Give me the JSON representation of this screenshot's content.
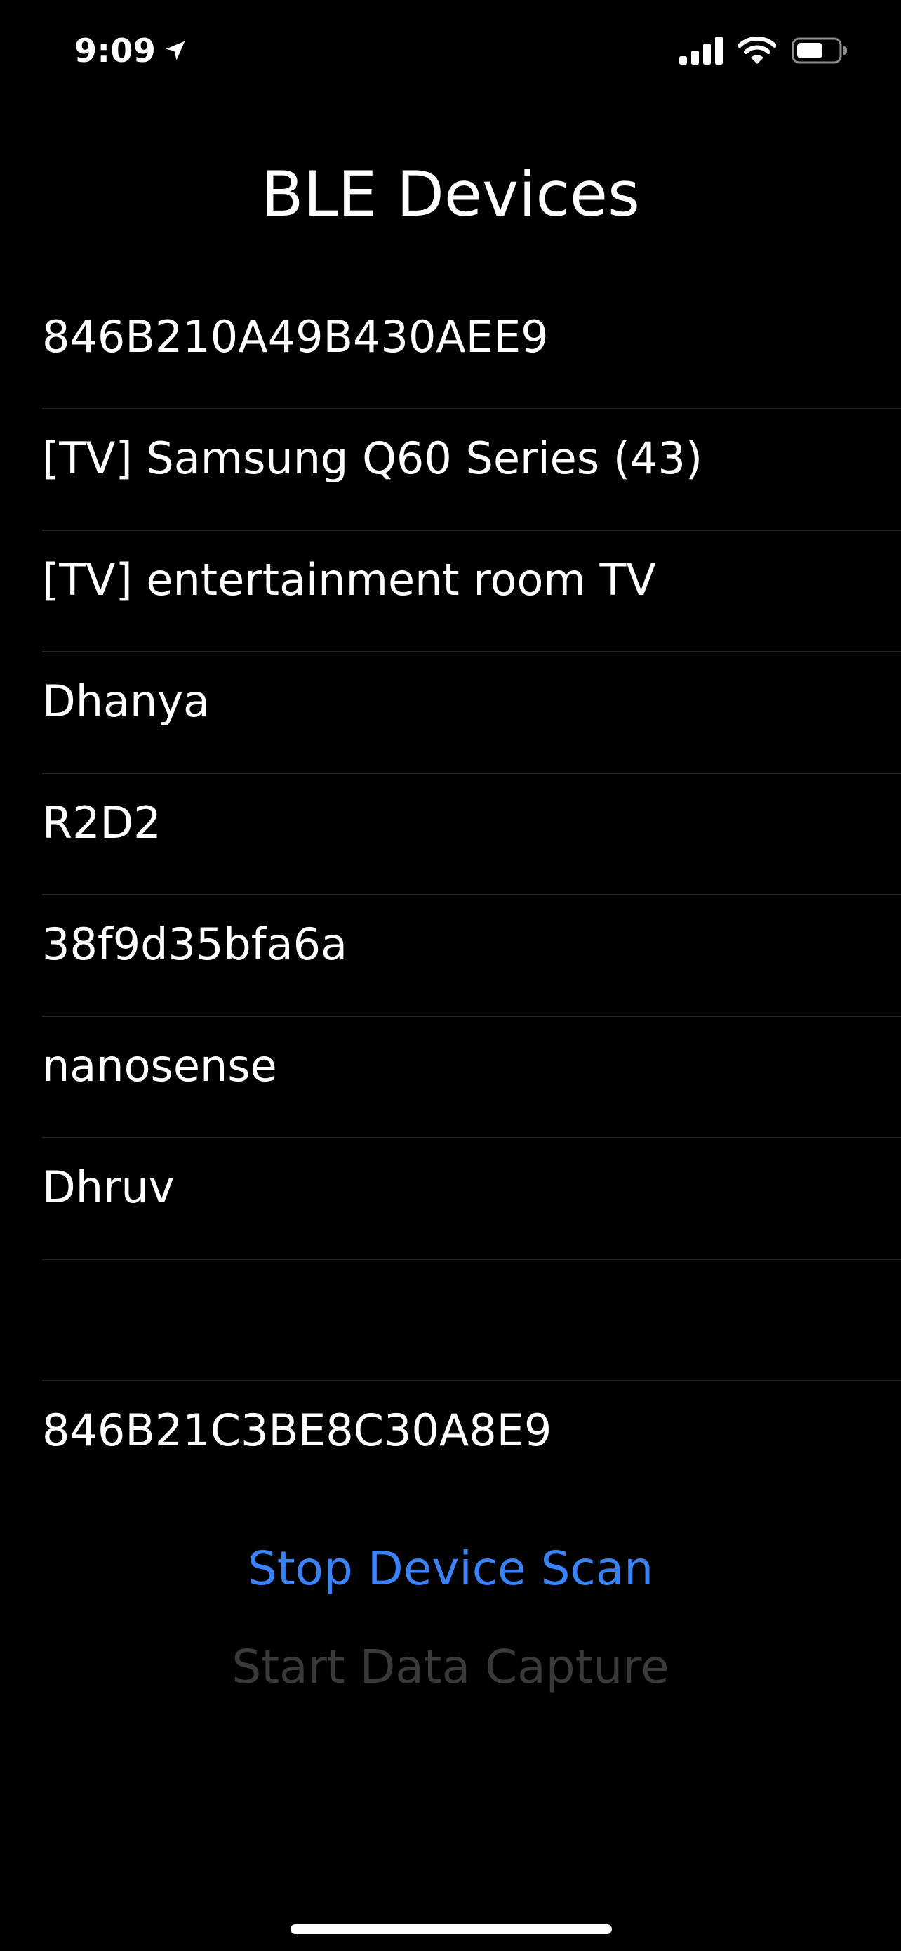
{
  "status_bar": {
    "time": "9:09"
  },
  "header": {
    "title": "BLE Devices"
  },
  "devices": [
    {
      "name": "846B210A49B430AEE9"
    },
    {
      "name": "[TV] Samsung Q60 Series (43)"
    },
    {
      "name": "[TV] entertainment room TV"
    },
    {
      "name": "Dhanya"
    },
    {
      "name": "R2D2"
    },
    {
      "name": "38f9d35bfa6a"
    },
    {
      "name": "nanosense"
    },
    {
      "name": "Dhruv"
    },
    {
      "name": ""
    },
    {
      "name": "846B21C3BE8C30A8E9"
    }
  ],
  "actions": {
    "stop_scan_label": "Stop Device Scan",
    "start_capture_label": "Start Data Capture"
  },
  "colors": {
    "background": "#000000",
    "accent": "#3a82f7",
    "disabled": "#3a3a3c",
    "separator": "#262628"
  },
  "icons": {
    "location": "location-arrow-icon",
    "signal": "cellular-signal-icon",
    "wifi": "wifi-icon",
    "battery": "battery-icon"
  }
}
